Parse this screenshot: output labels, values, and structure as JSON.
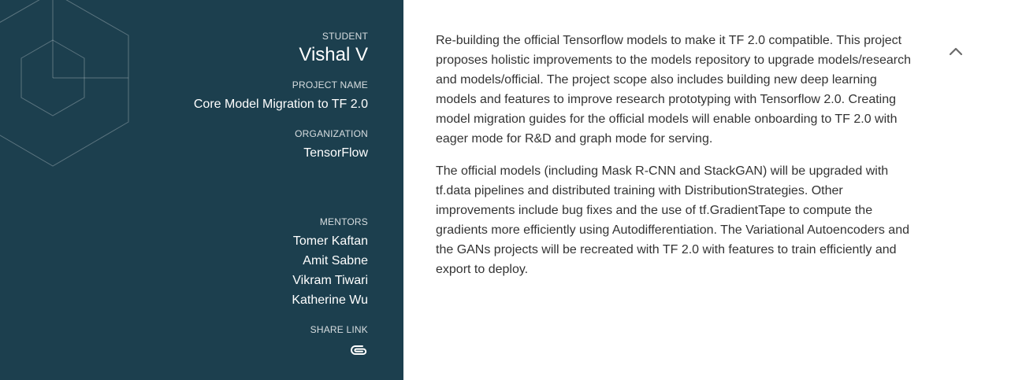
{
  "student": {
    "label": "STUDENT",
    "name": "Vishal V"
  },
  "project": {
    "label": "PROJECT NAME",
    "name": "Core Model Migration to TF 2.0"
  },
  "organization": {
    "label": "ORGANIZATION",
    "name": "TensorFlow"
  },
  "mentors": {
    "label": "MENTORS",
    "names": [
      "Tomer Kaftan",
      "Amit Sabne",
      "Vikram Tiwari",
      "Katherine Wu"
    ]
  },
  "share": {
    "label": "SHARE LINK",
    "icon": "link-icon"
  },
  "description": {
    "paragraphs": [
      "Re-building the official Tensorflow models to make it TF 2.0 compatible. This project proposes holistic improvements to the models repository to upgrade models/research and models/official. The project scope also includes building new deep learning models and features to improve research prototyping with Tensorflow 2.0. Creating model migration guides for the official models will enable onboarding to TF 2.0 with eager mode for R&D and graph mode for serving.",
      "The official models (including Mask R-CNN and StackGAN) will be upgraded with tf.data pipelines and distributed training with DistributionStrategies. Other improvements include bug fixes and the use of tf.GradientTape to compute the gradients more efficiently using Autodifferentiation. The Variational Autoencoders and the GANs projects will be recreated with TF 2.0 with features to train efficiently and export to deploy."
    ]
  },
  "collapse": {
    "icon": "chevron-up-icon"
  },
  "colors": {
    "sidebar_bg": "#1c3f4e",
    "text": "#333333"
  }
}
